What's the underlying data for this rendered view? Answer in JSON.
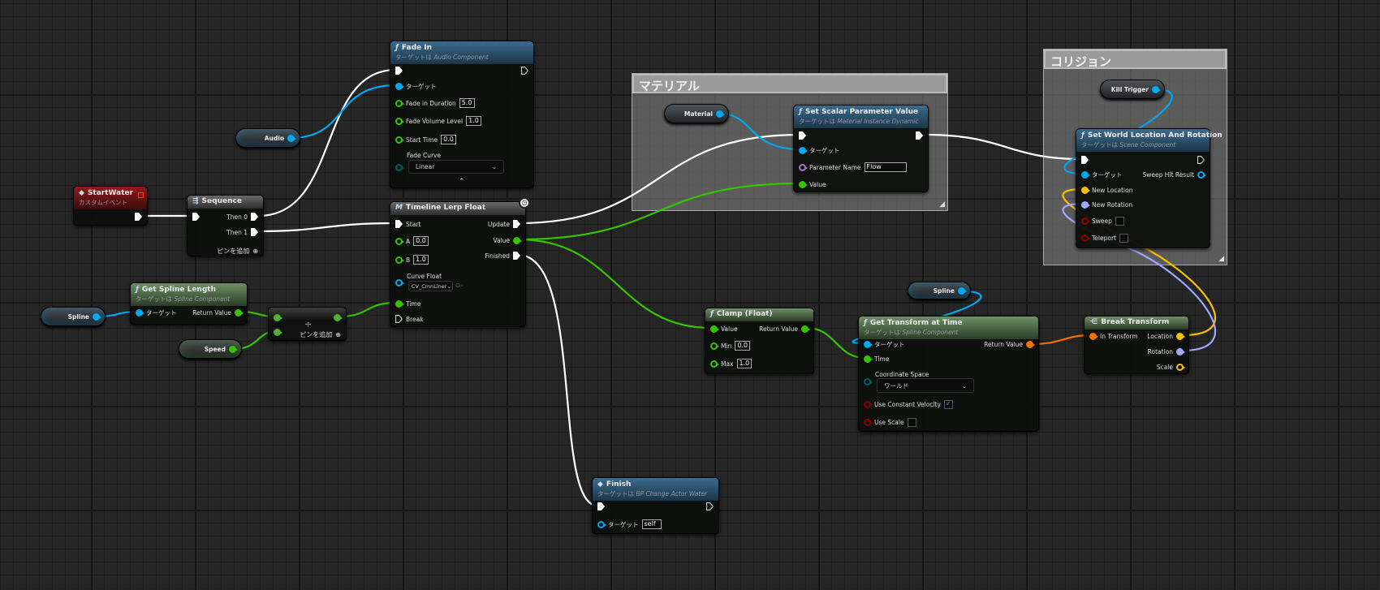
{
  "colors": {
    "exec": "#ffffff",
    "object": "#00a8f0",
    "float": "#37c400",
    "bool": "#8b0000",
    "enum": "#00605a",
    "transform": "#f07000",
    "vector": "#f5c000",
    "rotator": "#a0a8ff",
    "name": "#b070d0"
  },
  "comments": {
    "material": "マテリアル",
    "collision": "コリジョン"
  },
  "start_water": {
    "title": "StartWater",
    "subtitle": "カスタムイベント",
    "icon": "event-diamond-icon"
  },
  "sequence": {
    "title": "Sequence",
    "then0": "Then 0",
    "then1": "Then 1",
    "add_pin": "ピンを追加",
    "icon": "sequence-icon"
  },
  "audio_var": {
    "label": "Audio"
  },
  "fade_in": {
    "title": "Fade In",
    "subtitle_prefix": "ターゲットは",
    "subtitle_class": "Audio Component",
    "target": "ターゲット",
    "duration_label": "Fade in Duration",
    "duration": "5.0",
    "volume_label": "Fade Volume Level",
    "volume": "1.0",
    "start_label": "Start Time",
    "start": "0.0",
    "curve_label": "Fade Curve",
    "curve": "Linear"
  },
  "timeline": {
    "title": "Timeline Lerp Float",
    "start": "Start",
    "a_label": "A",
    "a": "0.0",
    "b_label": "B",
    "b": "1.0",
    "curve_label": "Curve Float",
    "curve": "CV_CmnLiner",
    "time": "Time",
    "break": "Break",
    "update": "Update",
    "value": "Value",
    "finished": "Finished"
  },
  "spline_var": {
    "label": "Spline"
  },
  "get_spline_length": {
    "title": "Get Spline Length",
    "subtitle_prefix": "ターゲットは",
    "subtitle_class": "Spline Component",
    "target": "ターゲット",
    "return": "Return Value"
  },
  "divide": {
    "symbol": "÷",
    "add_pin": "ピンを追加"
  },
  "speed_var": {
    "label": "Speed"
  },
  "material_var": {
    "label": "Material"
  },
  "set_scalar": {
    "title": "Set Scalar Parameter Value",
    "subtitle_prefix": "ターゲットは",
    "subtitle_class": "Material Instance Dynamic",
    "target": "ターゲット",
    "param_label": "Parameter Name",
    "param": "Flow",
    "value": "Value"
  },
  "kill_trigger_var": {
    "label": "Kill Trigger"
  },
  "set_world": {
    "title": "Set World Location And Rotation",
    "subtitle_prefix": "ターゲットは",
    "subtitle_class": "Scene Component",
    "target": "ターゲット",
    "sweep_hit": "Sweep Hit Result",
    "new_location": "New Location",
    "new_rotation": "New Rotation",
    "sweep": "Sweep",
    "teleport": "Teleport",
    "sweep_checked": false,
    "teleport_checked": false
  },
  "clamp": {
    "title": "Clamp (Float)",
    "value": "Value",
    "return": "Return Value",
    "min_label": "Min",
    "min": "0.0",
    "max_label": "Max",
    "max": "1.0"
  },
  "spline_var2": {
    "label": "Spline"
  },
  "get_transform": {
    "title": "Get Transform at Time",
    "subtitle_prefix": "ターゲットは",
    "subtitle_class": "Spline Component",
    "target": "ターゲット",
    "time": "Time",
    "return": "Return Value",
    "coord_label": "Coordinate Space",
    "coord": "ワールド",
    "const_vel": "Use Constant Velocity",
    "const_vel_checked": true,
    "use_scale": "Use Scale",
    "use_scale_checked": false
  },
  "break_transform": {
    "title": "Break Transform",
    "in": "In Transform",
    "location": "Location",
    "rotation": "Rotation",
    "scale": "Scale"
  },
  "finish": {
    "title": "Finish",
    "subtitle_prefix": "ターゲットは",
    "subtitle_class": "BP Change Actor Water",
    "target": "ターゲット",
    "target_value": "self"
  }
}
